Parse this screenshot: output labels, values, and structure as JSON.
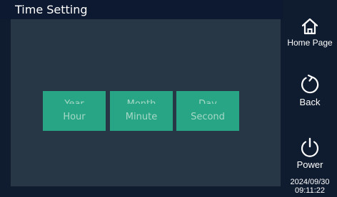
{
  "header": {
    "title": "Time Setting"
  },
  "time_fields": [
    {
      "label": "Year"
    },
    {
      "label": "Month"
    },
    {
      "label": "Day"
    },
    {
      "label": "Hour"
    },
    {
      "label": "Minute"
    },
    {
      "label": "Second"
    }
  ],
  "sidebar": {
    "home": {
      "label": "Home Page",
      "icon": "home-icon"
    },
    "back": {
      "label": "Back",
      "icon": "back-arrow-icon"
    },
    "power": {
      "label": "Power",
      "icon": "power-icon"
    }
  },
  "status": {
    "date": "2024/09/30",
    "time": "09:11:22"
  },
  "colors": {
    "background": "#0f1b2f",
    "panel": "#273746",
    "tile": "#27a584",
    "tile_text": "#a7d8c7",
    "text": "#ffffff"
  }
}
